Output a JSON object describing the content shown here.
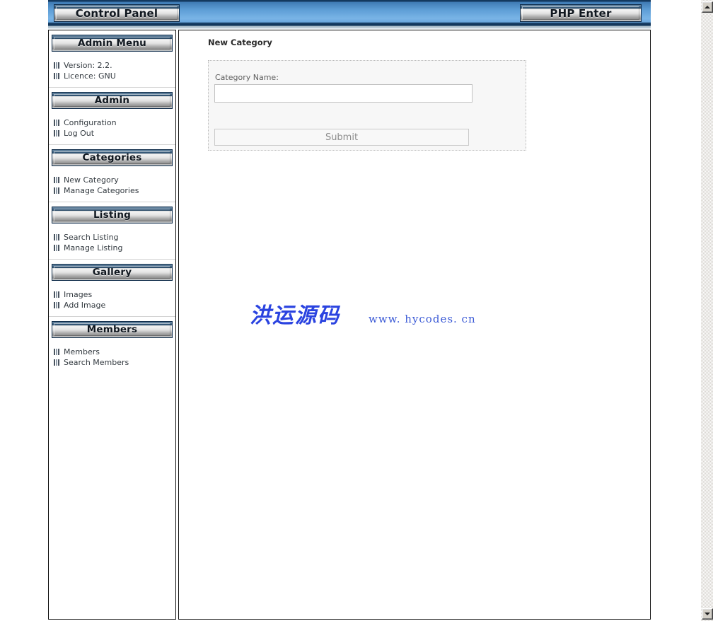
{
  "header": {
    "control_panel_label": "Control Panel",
    "php_enter_label": "PHP Enter"
  },
  "sidebar": {
    "sections": [
      {
        "title": "Admin Menu",
        "items": [
          {
            "label": "Version: 2.2.",
            "icon": "grid-bullet-icon",
            "interactable": false
          },
          {
            "label": "Licence: GNU",
            "icon": "grid-bullet-icon",
            "interactable": false
          }
        ]
      },
      {
        "title": "Admin",
        "items": [
          {
            "label": "Configuration",
            "icon": "grid-bullet-icon",
            "interactable": true
          },
          {
            "label": "Log Out",
            "icon": "grid-bullet-icon",
            "interactable": true
          }
        ]
      },
      {
        "title": "Categories",
        "items": [
          {
            "label": "New Category",
            "icon": "grid-bullet-icon",
            "interactable": true
          },
          {
            "label": "Manage Categories",
            "icon": "grid-bullet-icon",
            "interactable": true
          }
        ]
      },
      {
        "title": "Listing",
        "items": [
          {
            "label": "Search Listing",
            "icon": "grid-bullet-icon",
            "interactable": true
          },
          {
            "label": "Manage Listing",
            "icon": "grid-bullet-icon",
            "interactable": true
          }
        ]
      },
      {
        "title": "Gallery",
        "items": [
          {
            "label": "Images",
            "icon": "grid-bullet-icon",
            "interactable": true
          },
          {
            "label": "Add Image",
            "icon": "grid-bullet-icon",
            "interactable": true
          }
        ]
      },
      {
        "title": "Members",
        "items": [
          {
            "label": "Members",
            "icon": "grid-bullet-icon",
            "interactable": true
          },
          {
            "label": "Search Members",
            "icon": "grid-bullet-icon",
            "interactable": true
          }
        ]
      }
    ]
  },
  "content": {
    "page_title": "New Category",
    "form": {
      "category_name_label": "Category Name:",
      "category_name_value": "",
      "category_name_placeholder": "",
      "submit_label": "Submit"
    },
    "watermark": {
      "brand": "洪运源码",
      "url": "www. hycodes. cn"
    }
  },
  "scrollbar": {
    "up_icon": "scroll-up-arrow-icon",
    "down_icon": "scroll-down-arrow-icon"
  },
  "colors": {
    "header_blue": "#5e9ed6",
    "header_dark": "#13395f",
    "watermark_blue": "#2a43e0",
    "url_blue": "#3b5ad6"
  }
}
